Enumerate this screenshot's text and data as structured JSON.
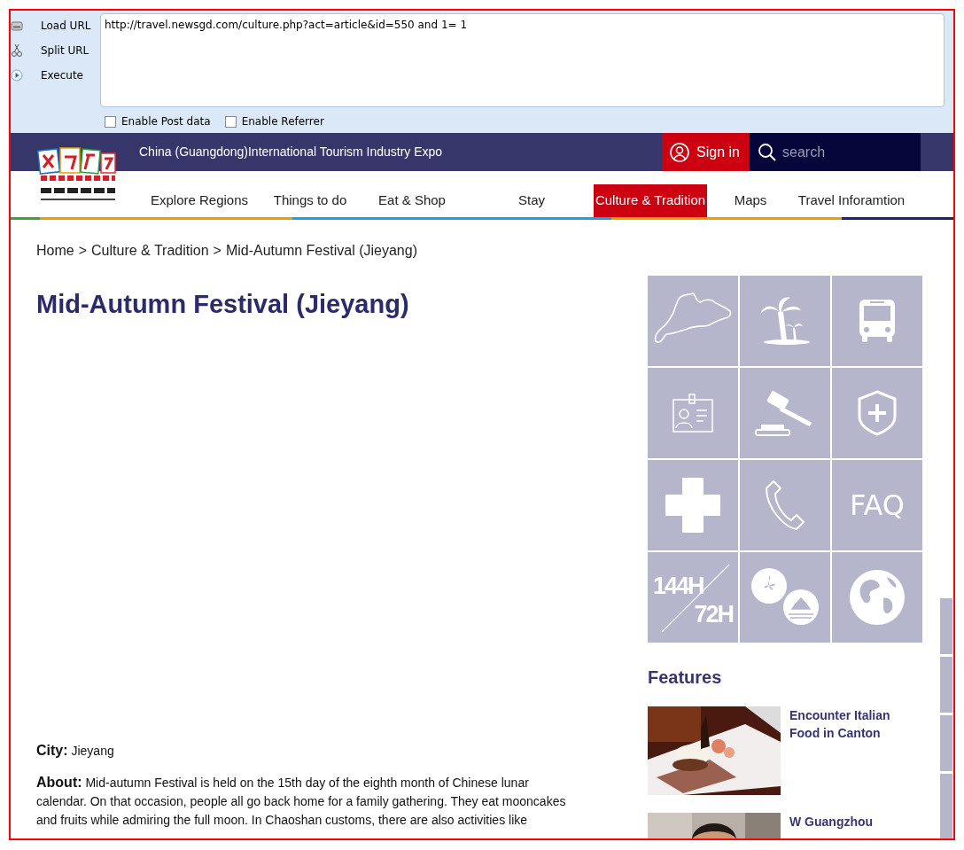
{
  "toolbar": {
    "buttons": [
      {
        "kind": "load",
        "label": "Load URL"
      },
      {
        "kind": "split",
        "label": "Split URL"
      },
      {
        "kind": "execute",
        "label": "Execute"
      }
    ],
    "url": "http://travel.newsgd.com/culture.php?act=article&id=550 and 1= 1",
    "options": [
      {
        "label": "Enable Post data",
        "checked": false
      },
      {
        "label": "Enable Referrer",
        "checked": false
      }
    ]
  },
  "header": {
    "tagline": "China (Guangdong)International Tourism Industry Expo",
    "sign_in": "Sign in",
    "search_placeholder": "search"
  },
  "nav": [
    {
      "label": "Explore Regions",
      "selected": false
    },
    {
      "label": "Things to do",
      "selected": false
    },
    {
      "label": "Eat & Shop",
      "selected": false
    },
    {
      "label": "Stay",
      "selected": false
    },
    {
      "label": "Culture & Tradition",
      "selected": true
    },
    {
      "label": "Maps",
      "selected": false
    },
    {
      "label": "Travel Inforamtion",
      "selected": false
    }
  ],
  "breadcrumb": {
    "separator": ">",
    "items": [
      "Home",
      "Culture & Tradition",
      "Mid-Autumn Festival (Jieyang)"
    ]
  },
  "article": {
    "title": "Mid-Autumn Festival (Jieyang)",
    "fields": [
      {
        "label": "City:",
        "value": "Jieyang"
      },
      {
        "label": "About:",
        "value": "Mid-autumn Festival is held on the 15th day of the eighth month of Chinese lunar calendar. On that occasion, people all go back home for a family gathering. They eat mooncakes and fruits while admiring the full moon. In Chaoshan customs, there are also activities like"
      }
    ]
  },
  "quick_links": [
    {
      "kind": "map"
    },
    {
      "kind": "palm"
    },
    {
      "kind": "bus"
    },
    {
      "kind": "id-card"
    },
    {
      "kind": "gavel"
    },
    {
      "kind": "shield"
    },
    {
      "kind": "cross"
    },
    {
      "kind": "phone"
    },
    {
      "kind": "text",
      "text": "FAQ"
    },
    {
      "kind": "transit",
      "top": "144H",
      "bottom": "72H"
    },
    {
      "kind": "flags"
    },
    {
      "kind": "globe"
    }
  ],
  "features": {
    "heading": "Features",
    "items": [
      {
        "title": "Encounter Italian Food in Canton",
        "kind": "picture"
      },
      {
        "title": "W Guangzhou",
        "kind": "picture"
      }
    ]
  }
}
